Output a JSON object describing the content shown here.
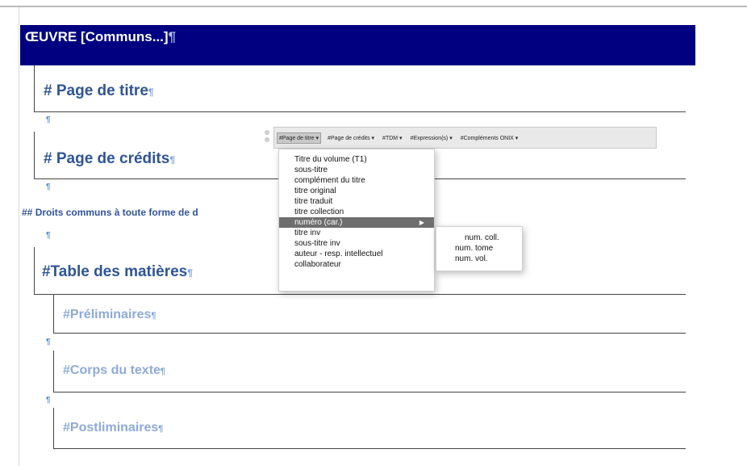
{
  "header": {
    "title": "ŒUVRE [Communs...]"
  },
  "pilcrow": "¶",
  "hash": "#",
  "hash2": "##",
  "sections": {
    "page_titre": "Page de titre",
    "page_credits": "Page de crédits",
    "droits": "Droits communs à toute forme de d",
    "table_matieres": "Table des matières",
    "preliminaires": "Préliminaires",
    "corps": "Corps du texte",
    "postliminaires": "Postliminaires"
  },
  "toolbar": {
    "buttons": [
      "#Page de titre ▾",
      "#Page de crédits ▾",
      "#TDM ▾",
      "#Expression(s) ▾",
      "#Compléments ONIX ▾"
    ]
  },
  "menu": {
    "items": [
      "Titre du volume (T1)",
      "sous-titre",
      "complément du titre",
      "titre original",
      "titre traduit",
      "titre collection",
      "numéro (car.)",
      "titre inv",
      "sous-titre inv",
      "auteur - resp. intellectuel",
      "collaborateur"
    ],
    "highlighted_index": 6,
    "submenu_arrow": "▶"
  },
  "submenu": {
    "items": [
      "num. coll.",
      "num. tome",
      "num. vol."
    ]
  },
  "colors": {
    "title_bar": "#000080",
    "heading": "#2f5496",
    "subheading": "#8eaadb",
    "highlight": "#6e6e6e"
  }
}
